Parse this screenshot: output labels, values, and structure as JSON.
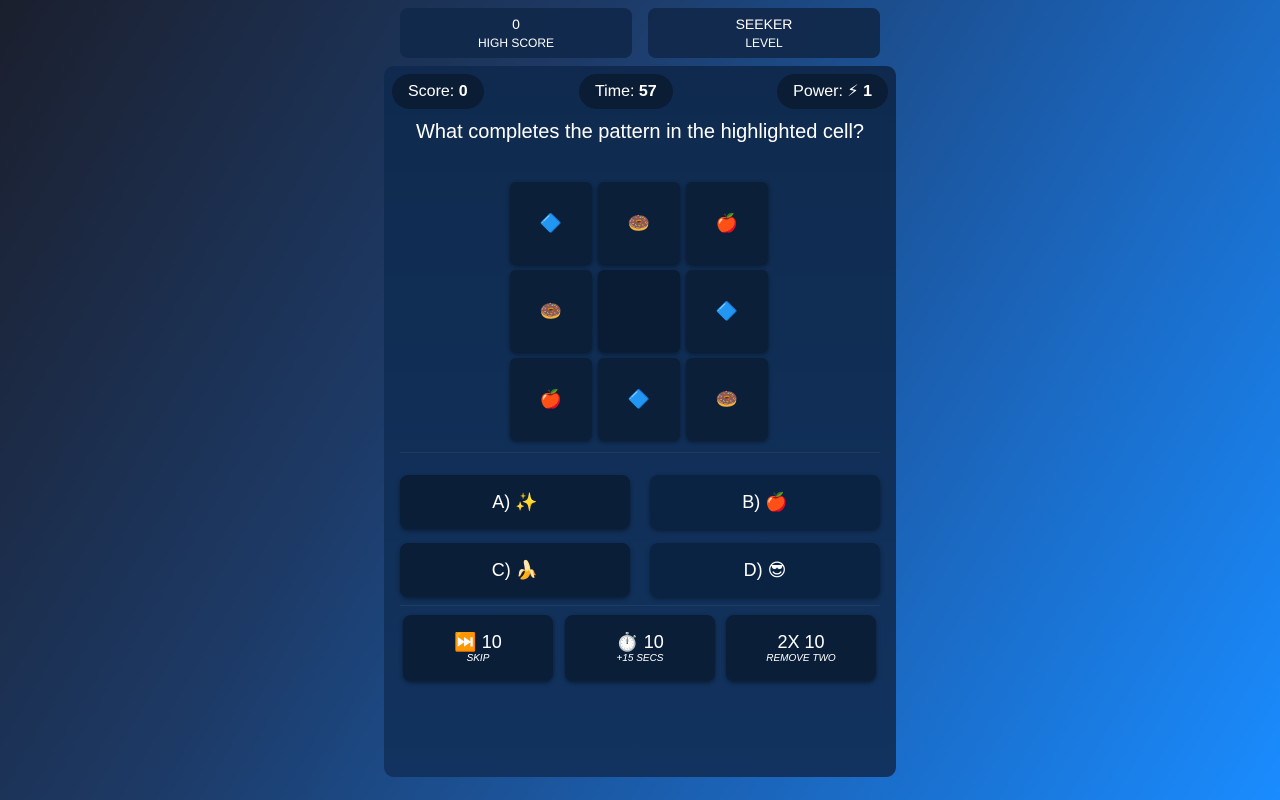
{
  "stats": {
    "high_score": {
      "value": "0",
      "label": "HIGH SCORE"
    },
    "level": {
      "value": "SEEKER",
      "label": "LEVEL"
    }
  },
  "hud": {
    "score_label": "Score:",
    "score_value": "0",
    "time_label": "Time:",
    "time_value": "57",
    "power_label": "Power: ⚡",
    "power_value": "1"
  },
  "question": "What completes the pattern in the highlighted cell?",
  "grid": [
    "🔷",
    "🍩",
    "🍎",
    "🍩",
    "",
    "🔷",
    "🍎",
    "🔷",
    "🍩"
  ],
  "answers": [
    {
      "label": "A) ✨"
    },
    {
      "label": "B) 🍎"
    },
    {
      "label": "C) 🍌"
    },
    {
      "label": "D) 😎"
    }
  ],
  "powerups": [
    {
      "title": "⏭️ 10",
      "subtitle": "SKIP"
    },
    {
      "title": "⏱️ 10",
      "subtitle": "+15 SECS"
    },
    {
      "title": "2X 10",
      "subtitle": "REMOVE TWO"
    }
  ]
}
